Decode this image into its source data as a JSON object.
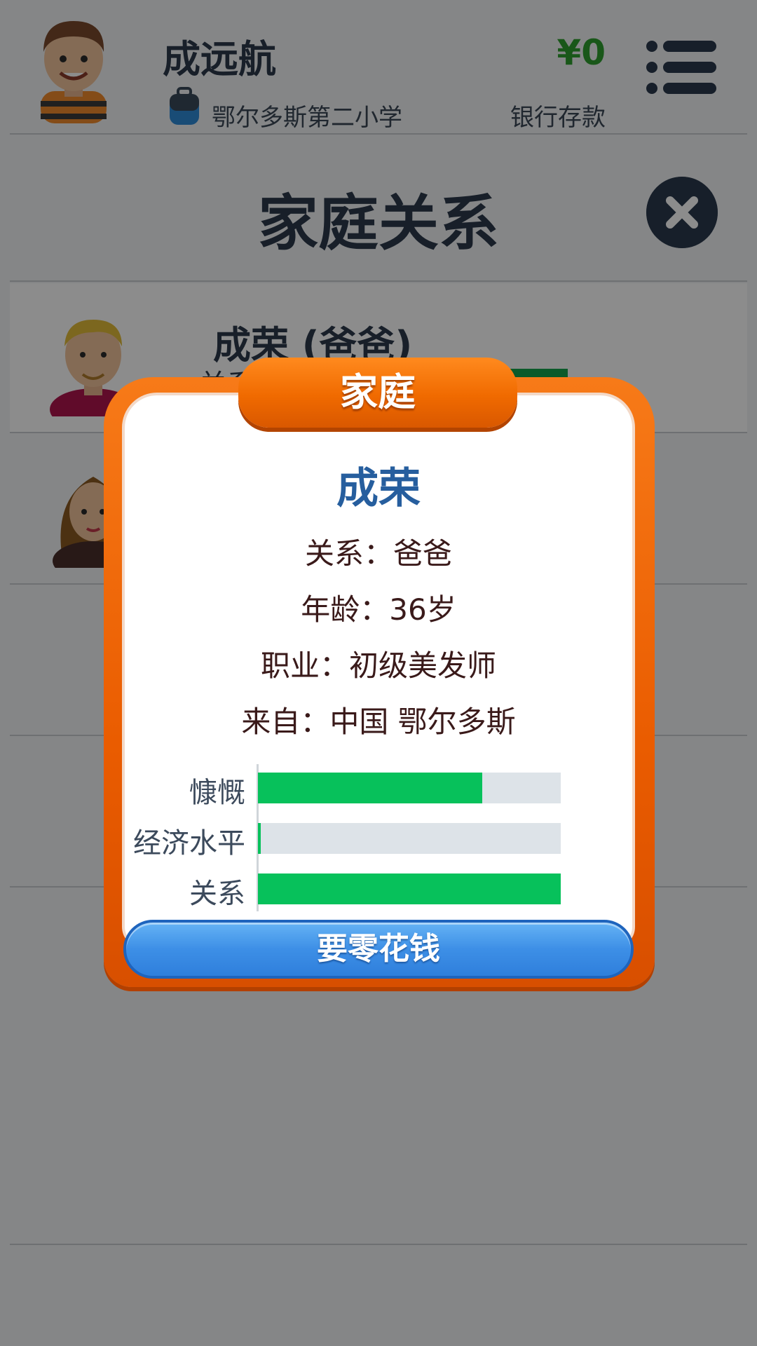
{
  "header": {
    "player_name": "成远航",
    "school": "鄂尔多斯第二小学",
    "money": "¥0",
    "bank_label": "银行存款"
  },
  "page": {
    "title": "家庭关系"
  },
  "family_list": [
    {
      "name": "成荣 (爸爸)",
      "relation_label": "关系"
    },
    {
      "name": ""
    }
  ],
  "modal": {
    "tab_title": "家庭",
    "name": "成荣",
    "relation_key": "关系：",
    "relation_value": "爸爸",
    "age_key": "年龄：",
    "age_value": "36岁",
    "job_key": "职业：",
    "job_value": "初级美发师",
    "origin_key": "来自：",
    "origin_value": "中国 鄂尔多斯",
    "stats": [
      {
        "label": "慷慨",
        "value": 0.74
      },
      {
        "label": "经济水平",
        "value": 0.01
      },
      {
        "label": "关系",
        "value": 1.0
      }
    ],
    "button_label": "要零花钱"
  },
  "colors": {
    "accent_orange": "#ea5c00",
    "bar_green": "#07c15b",
    "money_green": "#2f9e2f",
    "button_blue": "#3d8fe6"
  }
}
